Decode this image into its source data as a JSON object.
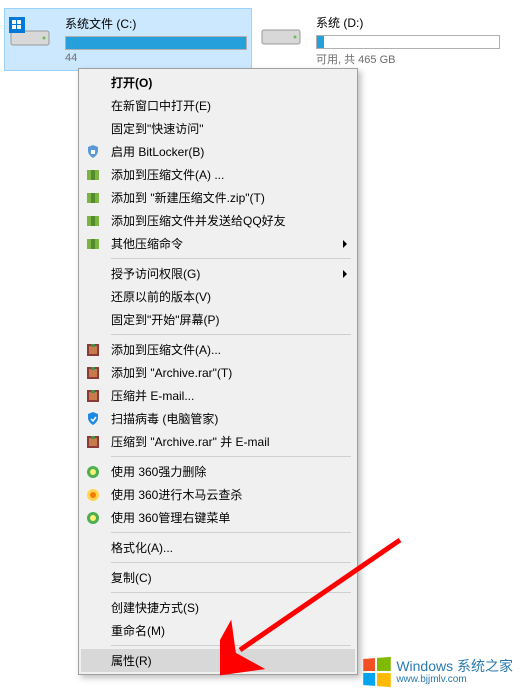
{
  "drives": {
    "c": {
      "label": "系统文件 (C:)",
      "space_prefix": "44"
    },
    "d": {
      "label": "系统 (D:)",
      "space": "可用, 共 465 GB"
    }
  },
  "menu": {
    "open": "打开(O)",
    "open_new_window": "在新窗口中打开(E)",
    "pin_quick_access": "固定到\"快速访问\"",
    "bitlocker": "启用 BitLocker(B)",
    "add_archive_a": "添加到压缩文件(A) ...",
    "add_archive_new": "添加到 \"新建压缩文件.zip\"(T)",
    "add_archive_qq": "添加到压缩文件并发送给QQ好友",
    "other_compress": "其他压缩命令",
    "grant_access": "授予访问权限(G)",
    "restore_previous": "还原以前的版本(V)",
    "pin_start": "固定到\"开始\"屏幕(P)",
    "winrar_add_a": "添加到压缩文件(A)...",
    "winrar_add_archive": "添加到 \"Archive.rar\"(T)",
    "winrar_email": "压缩并 E-mail...",
    "scan_virus": "扫描病毒 (电脑管家)",
    "winrar_archive_email": "压缩到 \"Archive.rar\" 并 E-mail",
    "360_force_delete": "使用 360强力删除",
    "360_trojan": "使用 360进行木马云查杀",
    "360_rightclick": "使用 360管理右键菜单",
    "format": "格式化(A)...",
    "copy": "复制(C)",
    "create_shortcut": "创建快捷方式(S)",
    "rename": "重命名(M)",
    "properties": "属性(R)"
  },
  "watermark": {
    "main": "Windows 系统之家",
    "sub": "www.bjjmlv.com"
  },
  "colors": {
    "selection": "#cce8ff",
    "progress": "#26a0da",
    "menu_highlight": "#d8d8d8"
  }
}
